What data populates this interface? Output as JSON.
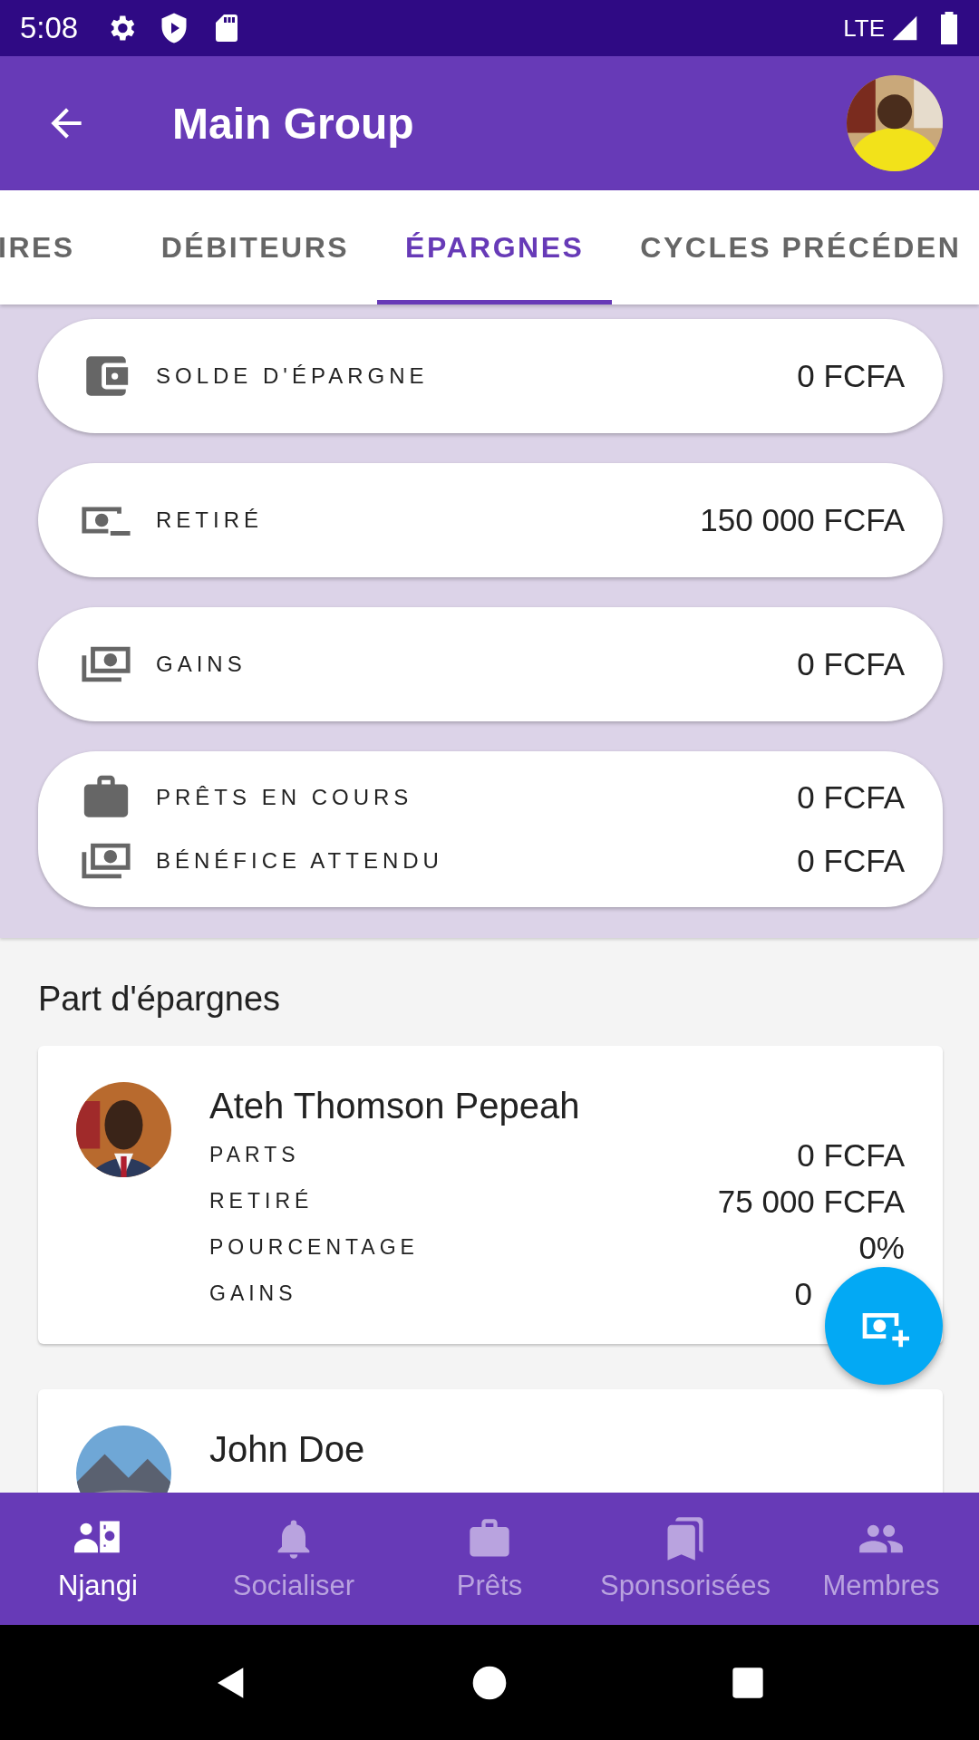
{
  "status_bar": {
    "time": "5:08",
    "network": "LTE"
  },
  "app_bar": {
    "title": "Main Group"
  },
  "tabs": [
    {
      "label": "IRES",
      "selected": false
    },
    {
      "label": "DÉBITEURS",
      "selected": false
    },
    {
      "label": "ÉPARGNES",
      "selected": true
    },
    {
      "label": "CYCLES PRÉCÉDEN",
      "selected": false
    }
  ],
  "summary_cards": [
    {
      "rows": [
        {
          "label": "SOLDE D'ÉPARGNE",
          "value": "0 FCFA"
        }
      ]
    },
    {
      "rows": [
        {
          "label": "RETIRÉ",
          "value": "150 000 FCFA"
        }
      ]
    },
    {
      "rows": [
        {
          "label": "GAINS",
          "value": "0 FCFA"
        }
      ]
    },
    {
      "rows": [
        {
          "label": "PRÊTS EN COURS",
          "value": "0 FCFA"
        },
        {
          "label": "BÉNÉFICE ATTENDU",
          "value": "0 FCFA"
        }
      ]
    }
  ],
  "section_title": "Part d'épargnes",
  "members": [
    {
      "name": "Ateh Thomson Pepeah",
      "fields": [
        {
          "label": "PARTS",
          "value": "0 FCFA"
        },
        {
          "label": "RETIRÉ",
          "value": "75 000 FCFA"
        },
        {
          "label": "POURCENTAGE",
          "value": "0%"
        },
        {
          "label": "GAINS",
          "value": "0"
        }
      ]
    },
    {
      "name": "John Doe"
    }
  ],
  "bottom_nav": [
    {
      "label": "Njangi",
      "selected": true
    },
    {
      "label": "Socialiser",
      "selected": false
    },
    {
      "label": "Prêts",
      "selected": false
    },
    {
      "label": "Sponsorisées",
      "selected": false
    },
    {
      "label": "Membres",
      "selected": false
    }
  ]
}
